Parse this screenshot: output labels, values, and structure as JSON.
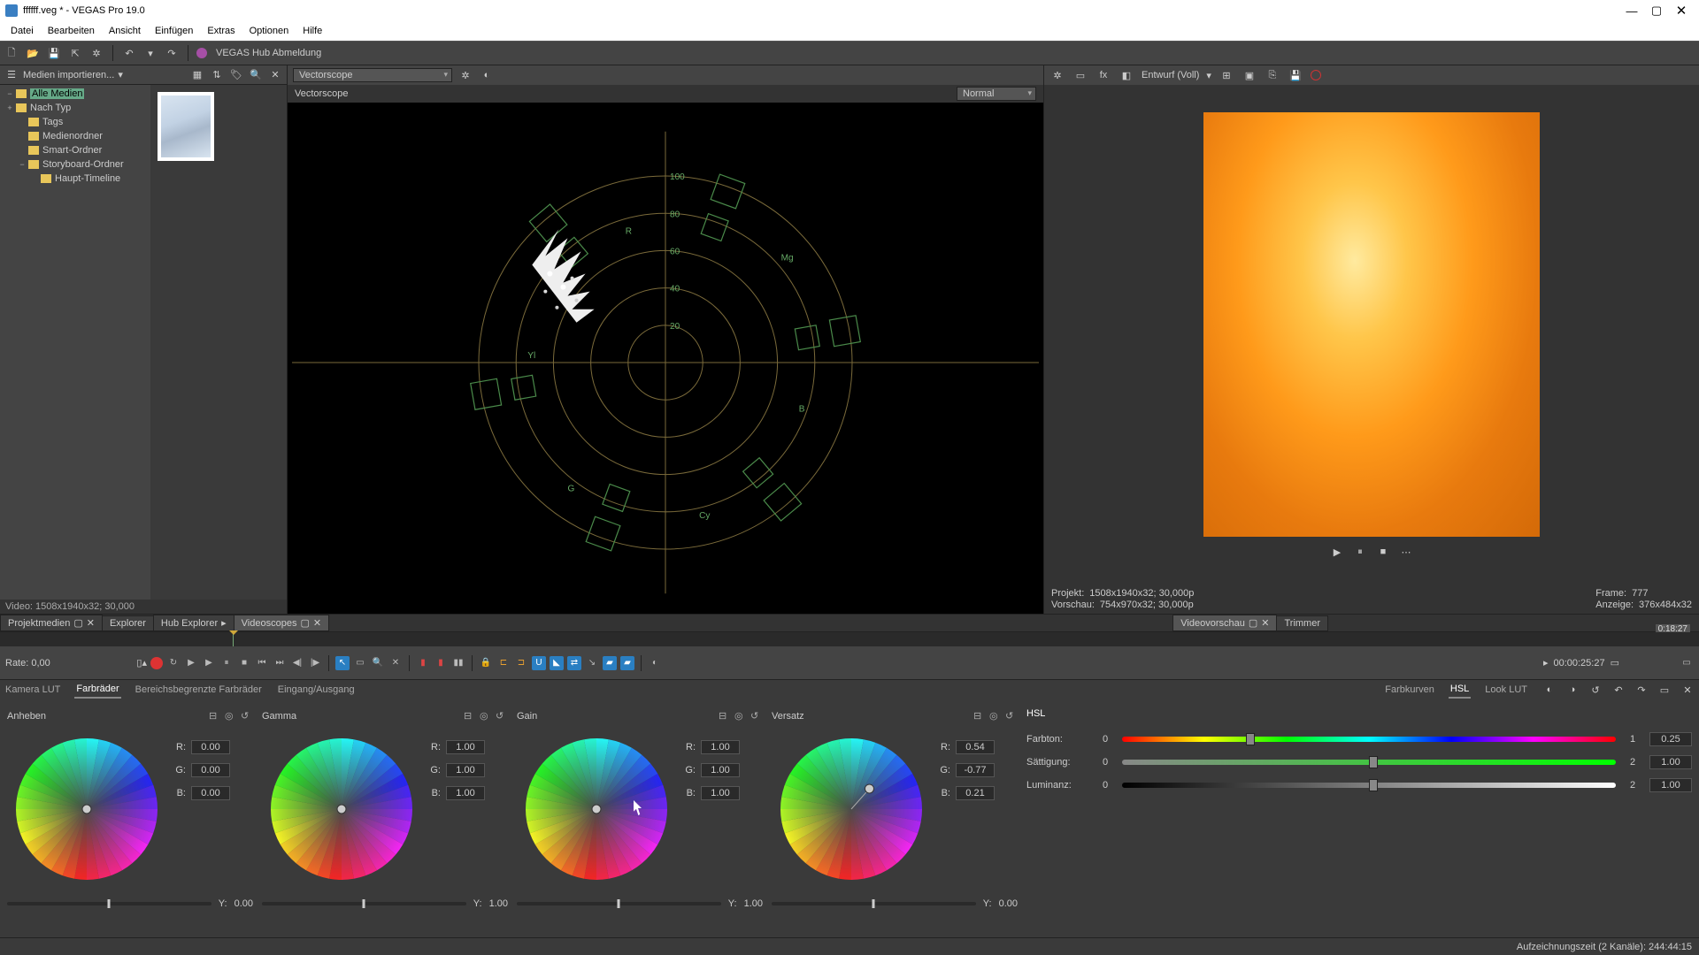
{
  "window": {
    "title": "ffffff.veg * - VEGAS Pro 19.0"
  },
  "menu": [
    "Datei",
    "Bearbeiten",
    "Ansicht",
    "Einfügen",
    "Extras",
    "Optionen",
    "Hilfe"
  ],
  "hub": {
    "label": "VEGAS Hub Abmeldung"
  },
  "media": {
    "import_label": "Medien importieren...",
    "tree": [
      {
        "label": "Alle Medien",
        "selected": true,
        "indent": 0,
        "expander": "−"
      },
      {
        "label": "Nach Typ",
        "indent": 0,
        "expander": "+"
      },
      {
        "label": "Tags",
        "indent": 1
      },
      {
        "label": "Medienordner",
        "indent": 1
      },
      {
        "label": "Smart-Ordner",
        "indent": 1
      },
      {
        "label": "Storyboard-Ordner",
        "indent": 1,
        "expander": "−"
      },
      {
        "label": "Haupt-Timeline",
        "indent": 2
      }
    ],
    "video_info": "Video: 1508x1940x32; 30,000"
  },
  "scope": {
    "dropdown": "Vectorscope",
    "label": "Vectorscope",
    "mode": "Normal",
    "targets": [
      "R",
      "Mg",
      "B",
      "Cy",
      "G",
      "Yl"
    ],
    "rings": [
      "20",
      "40",
      "60",
      "80",
      "100"
    ]
  },
  "preview": {
    "quality": "Entwurf (Voll)",
    "project_lbl": "Projekt:",
    "project_val": "1508x1940x32; 30,000p",
    "vorschau_lbl": "Vorschau:",
    "vorschau_val": "754x970x32; 30,000p",
    "frame_lbl": "Frame:",
    "frame_val": "777",
    "anzeige_lbl": "Anzeige:",
    "anzeige_val": "376x484x32"
  },
  "panel_tabs_left": [
    "Projektmedien",
    "Explorer",
    "Hub Explorer",
    "Videoscopes"
  ],
  "panel_tabs_right": [
    "Videovorschau",
    "Trimmer"
  ],
  "timeline": {
    "rate_label": "Rate: 0,00",
    "ruler_time": "0:18:27",
    "timecode": "00:00:25:27"
  },
  "grading": {
    "left_tabs": [
      "Kamera LUT",
      "Farbräder",
      "Bereichsbegrenzte Farbräder",
      "Eingang/Ausgang"
    ],
    "right_tabs": [
      "Farbkurven",
      "HSL",
      "Look LUT"
    ],
    "wheels": [
      {
        "title": "Anheben",
        "R": "0.00",
        "G": "0.00",
        "B": "0.00",
        "Y": "0.00",
        "px": 0.5,
        "py": 0.5
      },
      {
        "title": "Gamma",
        "R": "1.00",
        "G": "1.00",
        "B": "1.00",
        "Y": "1.00",
        "px": 0.5,
        "py": 0.5
      },
      {
        "title": "Gain",
        "R": "1.00",
        "G": "1.00",
        "B": "1.00",
        "Y": "1.00",
        "px": 0.5,
        "py": 0.5
      },
      {
        "title": "Versatz",
        "R": "0.54",
        "G": "-0.77",
        "B": "0.21",
        "Y": "0.00",
        "px": 0.66,
        "py": 0.32
      }
    ],
    "hsl": {
      "title": "HSL",
      "rows": [
        {
          "label": "Farbton:",
          "min": "0",
          "max": "1",
          "val": "0.25",
          "pos": 25,
          "grad": "hue-grad"
        },
        {
          "label": "Sättigung:",
          "min": "0",
          "max": "2",
          "val": "1.00",
          "pos": 50,
          "grad": "sat-grad"
        },
        {
          "label": "Luminanz:",
          "min": "0",
          "max": "2",
          "val": "1.00",
          "pos": 50,
          "grad": "lum-grad"
        }
      ]
    }
  },
  "status": {
    "rec": "Aufzeichnungszeit (2 Kanäle): 244:44:15"
  },
  "labels": {
    "R": "R:",
    "G": "G:",
    "B": "B:",
    "Y": "Y:"
  }
}
